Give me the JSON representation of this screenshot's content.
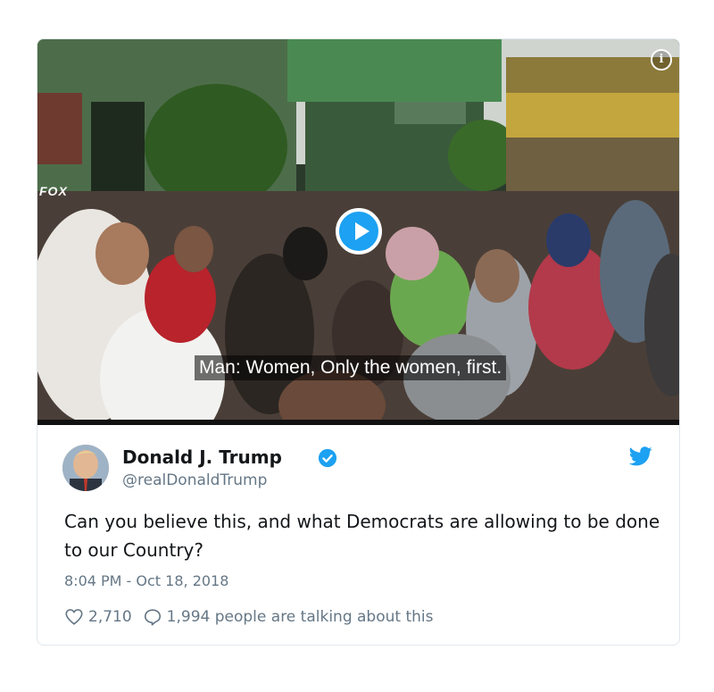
{
  "video": {
    "caption": "Man: Women, Only the women, first.",
    "logo_text": "FOX",
    "info_icon": "info-icon",
    "play_icon": "play-icon"
  },
  "tweet": {
    "author_name": "Donald J. Trump",
    "author_handle": "@realDonaldTrump",
    "verified_icon": "verified-badge-icon",
    "brand_icon": "twitter-bird-icon",
    "text": "Can you believe this, and what Democrats are allowing to be done to our Country?",
    "timestamp": "8:04 PM - Oct 18, 2018",
    "likes": "2,710",
    "conversation": "1,994 people are talking about this"
  },
  "colors": {
    "brand": "#1da1f2",
    "text": "#14171a",
    "muted": "#657786",
    "border": "#e1e8ed"
  }
}
